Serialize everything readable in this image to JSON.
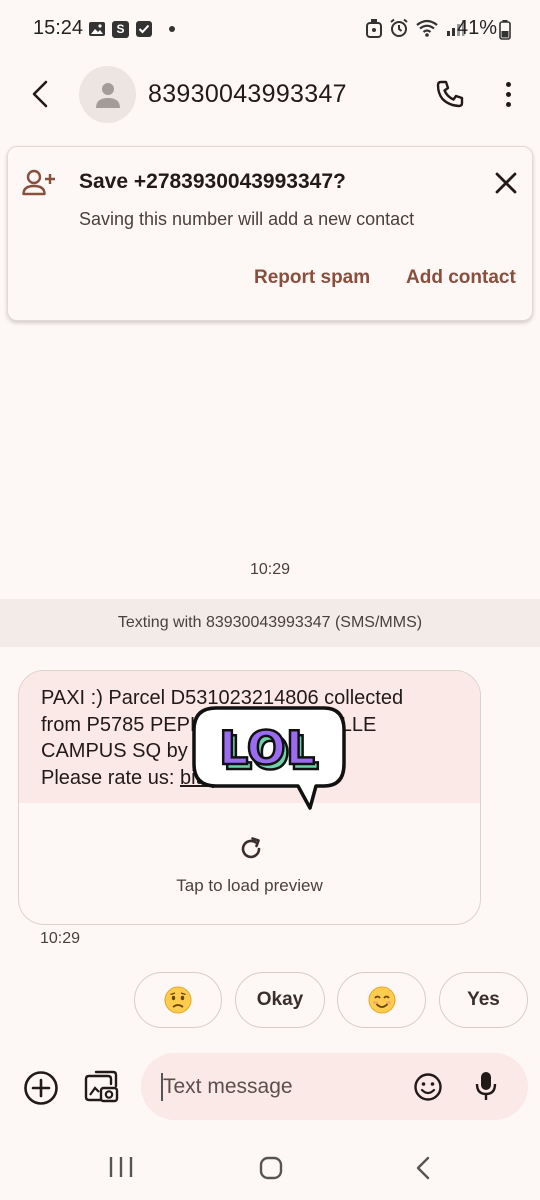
{
  "status_bar": {
    "time": "15:24",
    "battery": "41%"
  },
  "header": {
    "title": "83930043993347",
    "icons": [
      "back-arrow-icon",
      "avatar-person-icon",
      "phone-icon",
      "more-vert-icon"
    ]
  },
  "save_card": {
    "title": "Save +2783930043993347?",
    "subtitle": "Saving this number will add a new contact",
    "report_spam_label": "Report spam",
    "add_contact_label": "Add contact"
  },
  "conversation": {
    "time_divider": "10:29",
    "texting_banner": "Texting with 83930043993347 (SMS/MMS)",
    "message": {
      "line1": "PAXI :) Parcel D531023214806 collected",
      "line2": "from P5785 PEPKOR JHB MELVILLE",
      "line3": "CAMPUS SQ by Sibusisi Moyo.",
      "line4_prefix": "Please rate us: ",
      "line4_link": "bit.ly",
      "preview_label": "Tap to load preview",
      "time": "10:29"
    },
    "sticker_text": "LOL"
  },
  "quick_replies": {
    "okay": "Okay",
    "yes": "Yes",
    "emoji_sad": "worried-face-emoji",
    "emoji_smile": "smiling-face-emoji"
  },
  "compose": {
    "placeholder": "Text message"
  },
  "colors": {
    "accent": "#8a4f3c",
    "background": "#fdf8f6",
    "bubble": "#fae9e6",
    "banner": "#f3ebe8"
  }
}
